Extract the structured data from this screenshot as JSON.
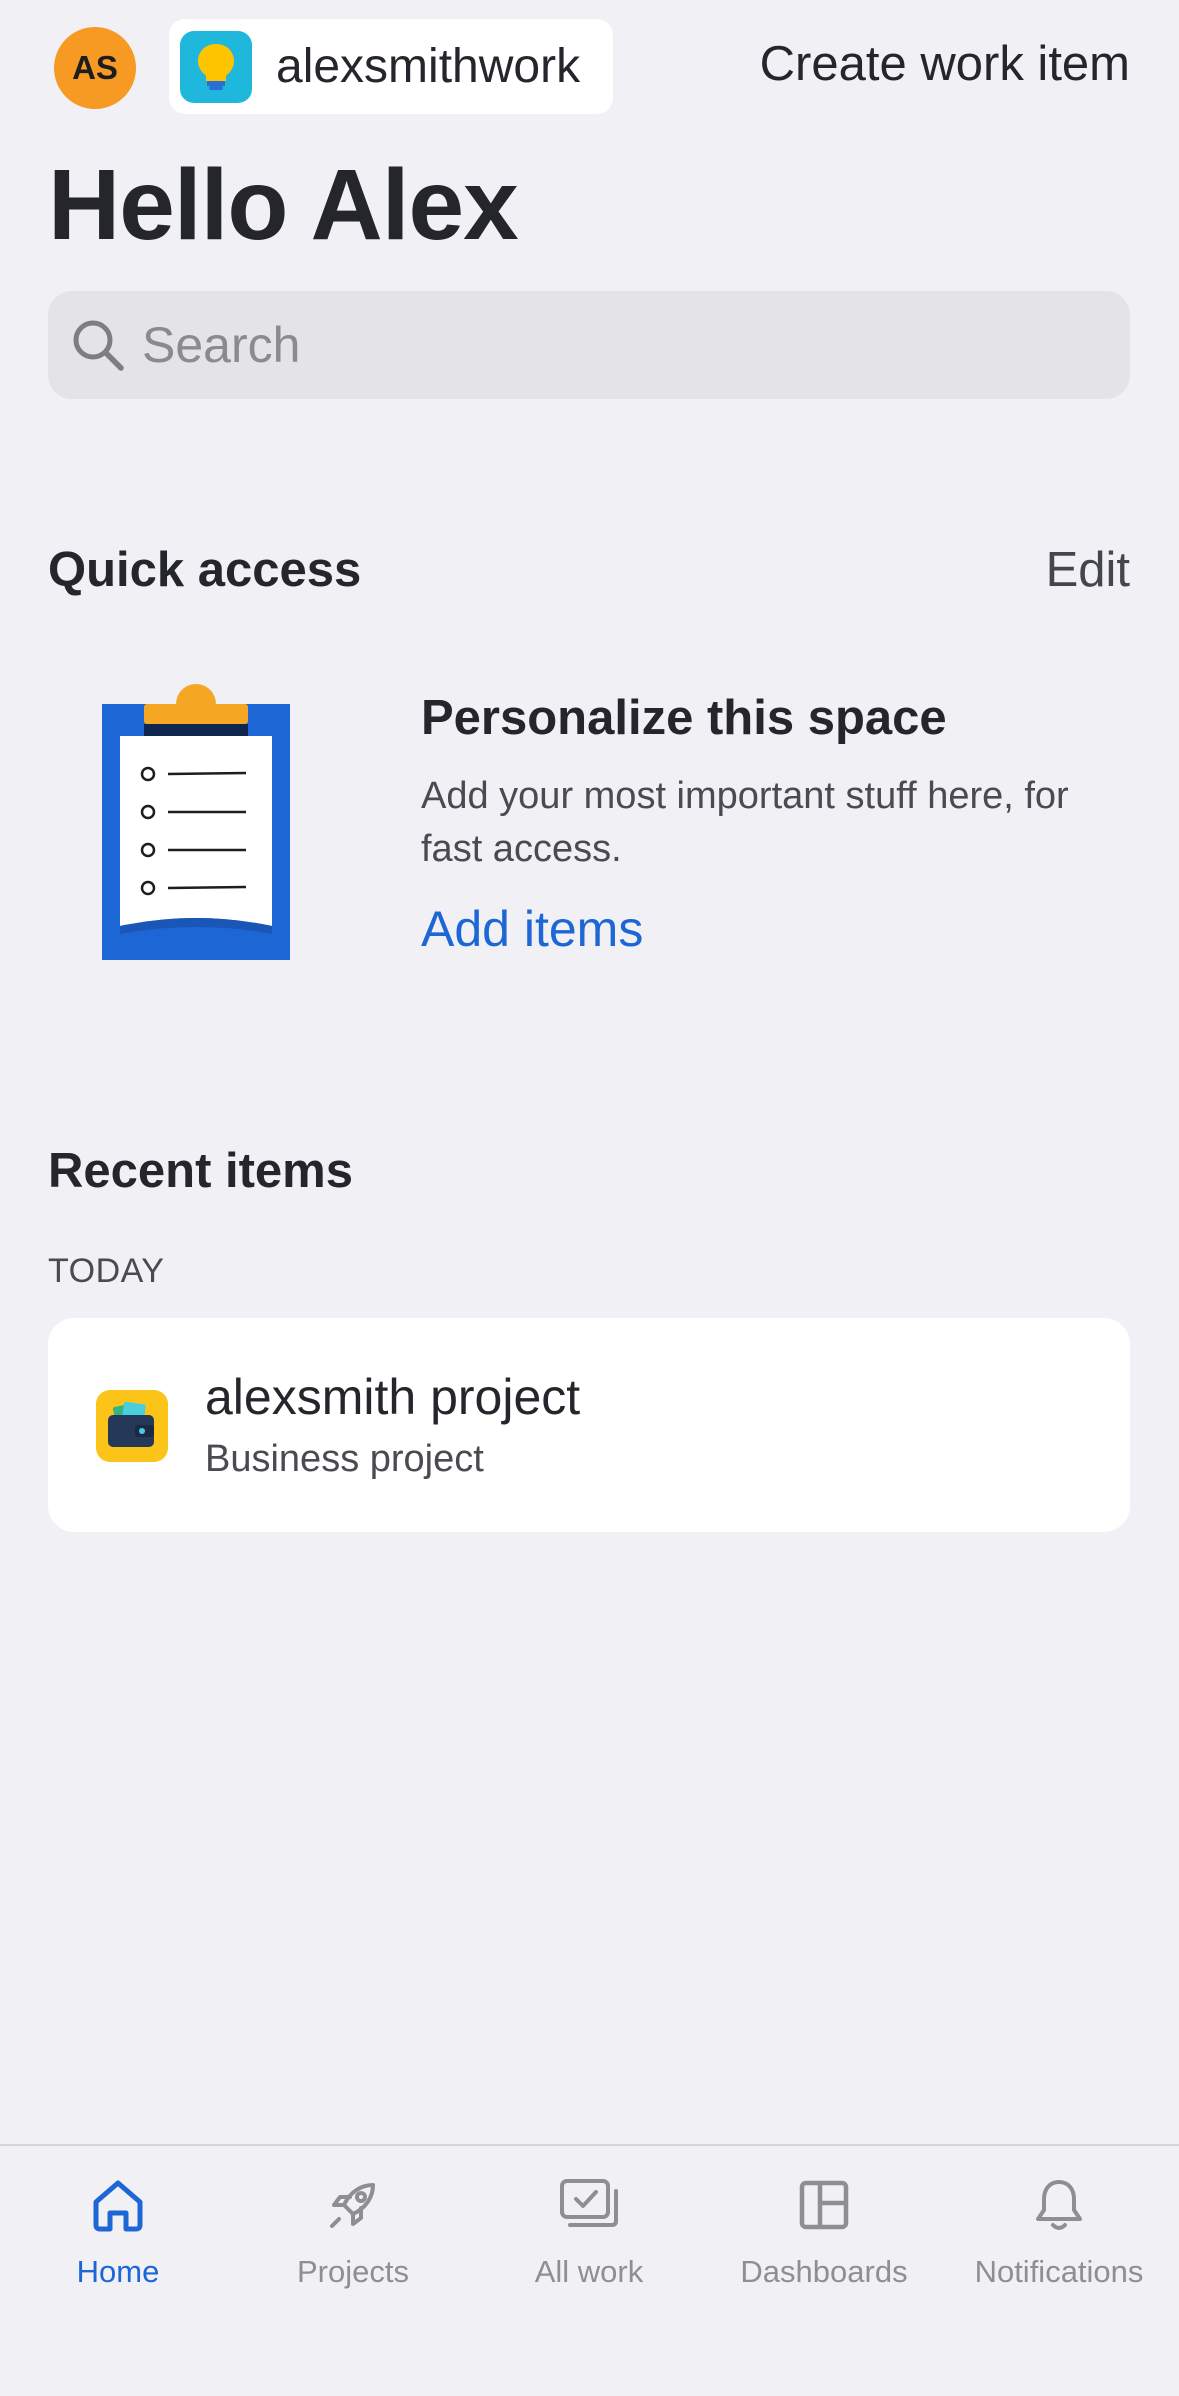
{
  "header": {
    "avatar_initials": "AS",
    "site_name": "alexsmithwork",
    "create_label": "Create work item"
  },
  "greeting": "Hello Alex",
  "search": {
    "placeholder": "Search",
    "value": ""
  },
  "quick_access": {
    "title": "Quick access",
    "edit_label": "Edit",
    "empty_title": "Personalize this space",
    "empty_description": "Add your most important stuff here, for fast access.",
    "add_label": "Add items"
  },
  "recent": {
    "title": "Recent items",
    "groups": [
      {
        "label": "TODAY",
        "items": [
          {
            "name": "alexsmith project",
            "type": "Business project",
            "icon": "wallet-icon"
          }
        ]
      }
    ]
  },
  "tabs": [
    {
      "label": "Home",
      "icon": "home-icon",
      "active": true
    },
    {
      "label": "Projects",
      "icon": "rocket-icon",
      "active": false
    },
    {
      "label": "All work",
      "icon": "checklist-icon",
      "active": false
    },
    {
      "label": "Dashboards",
      "icon": "dashboard-icon",
      "active": false
    },
    {
      "label": "Notifications",
      "icon": "bell-icon",
      "active": false
    }
  ],
  "colors": {
    "background": "#f0f0f5",
    "accent": "#1d66d6",
    "avatar": "#f79a23",
    "site_logo": "#1fb7dc",
    "project_icon": "#fcc419",
    "inactive_tab": "#8e8e93"
  }
}
